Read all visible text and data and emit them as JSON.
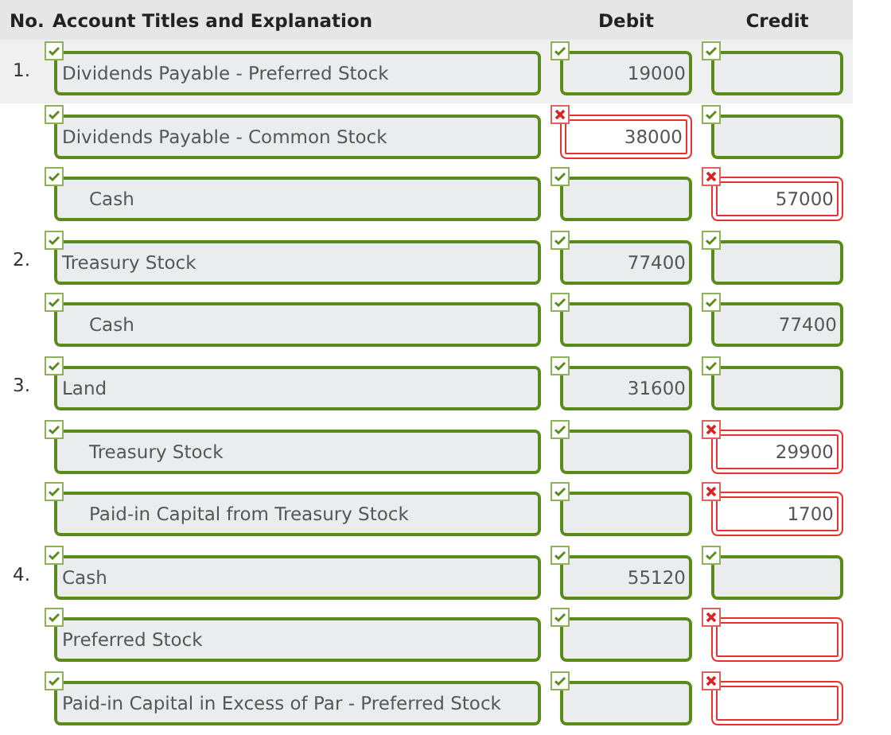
{
  "columns": [
    "No.",
    "Account Titles and Explanation",
    "Debit",
    "Credit"
  ],
  "lines": [
    {
      "number": "1.",
      "highlighted": true,
      "indented": false,
      "account": {
        "value": "Dividends Payable - Preferred Stock",
        "correct": true
      },
      "debit": {
        "value": "19000",
        "correct": true
      },
      "credit": {
        "correct": true
      }
    },
    {
      "highlighted": false,
      "indented": false,
      "account": {
        "value": "Dividends Payable - Common Stock",
        "correct": true
      },
      "debit": {
        "value": "38000",
        "correct": false
      },
      "credit": {
        "correct": true
      }
    },
    {
      "highlighted": false,
      "indented": true,
      "account": {
        "value": "Cash",
        "correct": true
      },
      "debit": {
        "correct": true
      },
      "credit": {
        "value": "57000",
        "correct": false
      }
    },
    {
      "number": "2.",
      "highlighted": false,
      "indented": false,
      "account": {
        "value": "Treasury Stock",
        "correct": true
      },
      "debit": {
        "value": "77400",
        "correct": true
      },
      "credit": {
        "correct": true
      }
    },
    {
      "highlighted": false,
      "indented": true,
      "account": {
        "value": "Cash",
        "correct": true
      },
      "debit": {
        "correct": true
      },
      "credit": {
        "value": "77400",
        "correct": true
      }
    },
    {
      "number": "3.",
      "highlighted": false,
      "indented": false,
      "account": {
        "value": "Land",
        "correct": true
      },
      "debit": {
        "value": "31600",
        "correct": true
      },
      "credit": {
        "correct": true
      }
    },
    {
      "highlighted": false,
      "indented": true,
      "account": {
        "value": "Treasury Stock",
        "correct": true
      },
      "debit": {
        "correct": true
      },
      "credit": {
        "value": "29900",
        "correct": false
      }
    },
    {
      "highlighted": false,
      "indented": true,
      "account": {
        "value": "Paid-in Capital from Treasury Stock",
        "correct": true
      },
      "debit": {
        "correct": true
      },
      "credit": {
        "value": "1700",
        "correct": false
      }
    },
    {
      "number": "4.",
      "highlighted": false,
      "indented": false,
      "account": {
        "value": "Cash",
        "correct": true
      },
      "debit": {
        "value": "55120",
        "correct": true
      },
      "credit": {
        "correct": true
      }
    },
    {
      "highlighted": false,
      "indented": false,
      "account": {
        "value": "Preferred Stock",
        "correct": true
      },
      "debit": {
        "correct": true
      },
      "credit": {
        "correct": false
      }
    },
    {
      "highlighted": false,
      "indented": false,
      "account": {
        "value": "Paid-in Capital in Excess of Par - Preferred Stock",
        "correct": true
      },
      "debit": {
        "correct": true
      },
      "credit": {
        "correct": false
      }
    }
  ]
}
